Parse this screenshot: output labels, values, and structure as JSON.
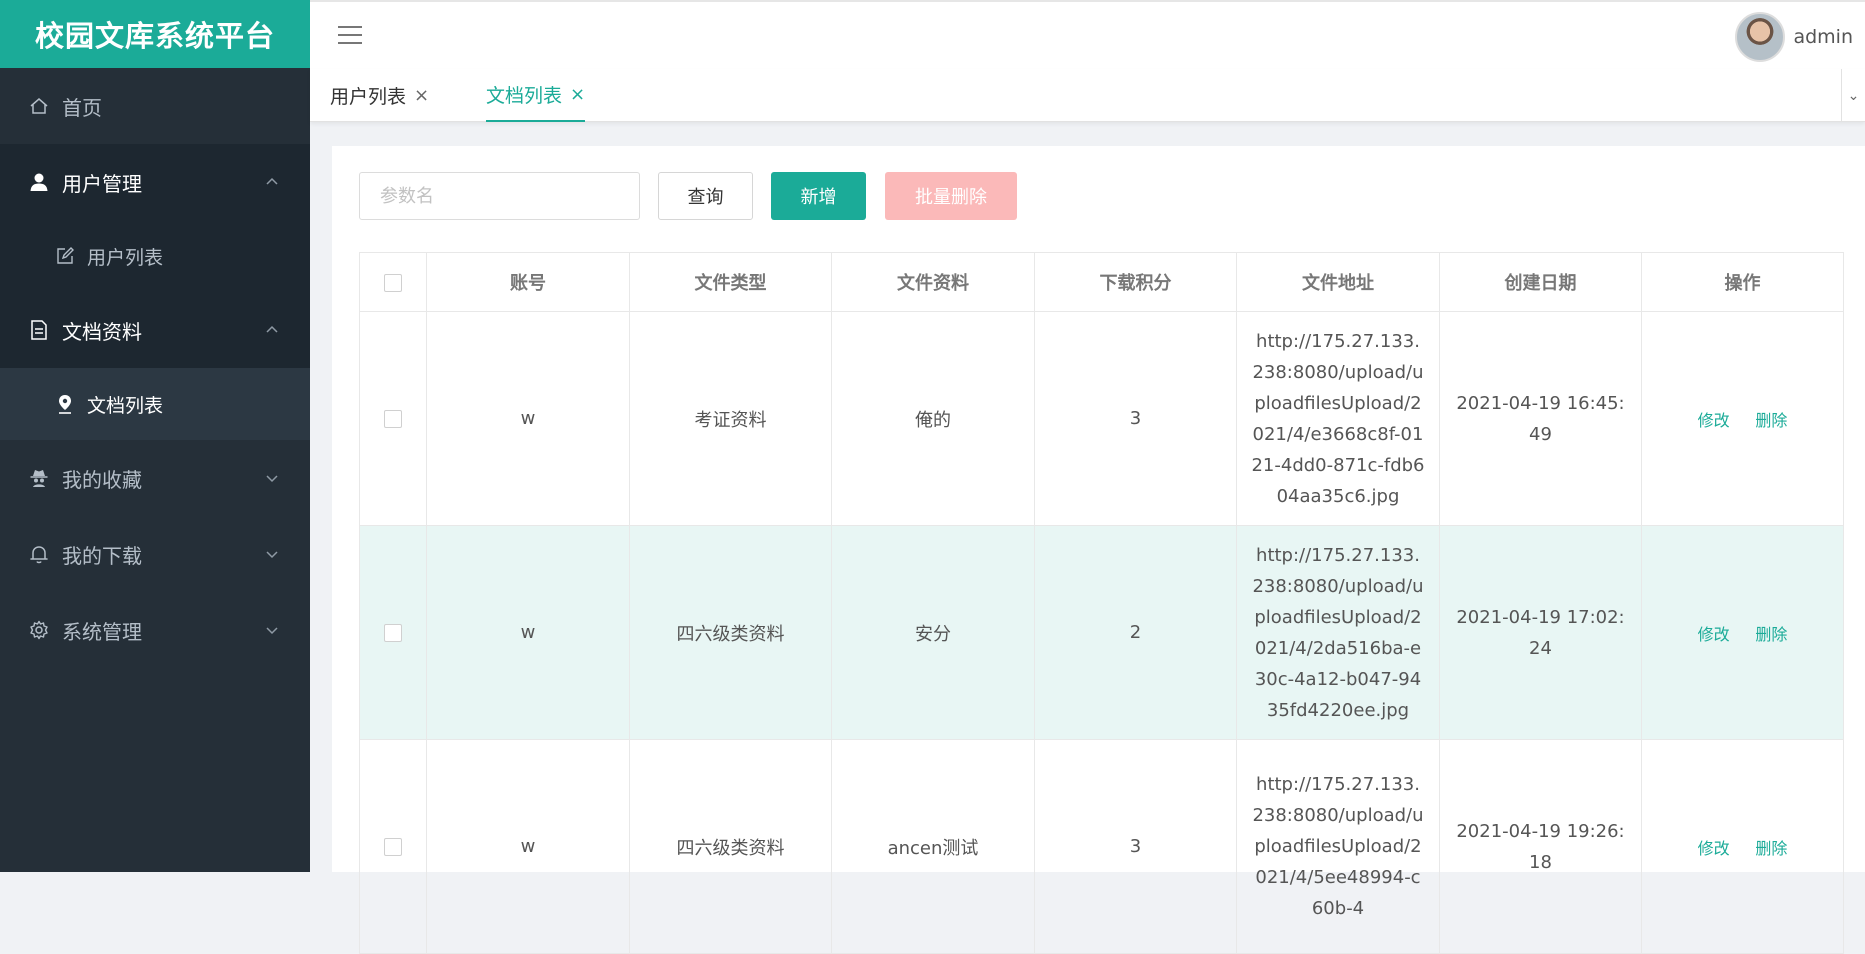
{
  "app": {
    "title": "校园文库系统平台"
  },
  "sidebar": {
    "home": "首页",
    "user_mgmt": "用户管理",
    "user_list": "用户列表",
    "doc": "文档资料",
    "doc_list": "文档列表",
    "favorites": "我的收藏",
    "downloads": "我的下载",
    "system": "系统管理"
  },
  "header": {
    "user": "admin"
  },
  "tabs": [
    {
      "label": "用户列表",
      "close": "×"
    },
    {
      "label": "文档列表",
      "close": "×"
    }
  ],
  "toolbar": {
    "search_placeholder": "参数名",
    "query": "查询",
    "add": "新增",
    "batch_delete": "批量删除"
  },
  "table": {
    "columns": [
      "账号",
      "文件类型",
      "文件资料",
      "下载积分",
      "文件地址",
      "创建日期",
      "操作"
    ],
    "rows": [
      {
        "account": "w",
        "type": "考证资料",
        "name": "俺的",
        "points": "3",
        "url": "http://175.27.133.238:8080/upload/uploadfilesUpload/2021/4/e3668c8f-0121-4dd0-871c-fdb604aa35c6.jpg",
        "date": "2021-04-19 16:45:49"
      },
      {
        "account": "w",
        "type": "四六级类资料",
        "name": "安分",
        "points": "2",
        "url": "http://175.27.133.238:8080/upload/uploadfilesUpload/2021/4/2da516ba-e30c-4a12-b047-9435fd4220ee.jpg",
        "date": "2021-04-19 17:02:24"
      },
      {
        "account": "w",
        "type": "四六级类资料",
        "name": "ancen测试",
        "points": "3",
        "url": "http://175.27.133.238:8080/upload/uploadfilesUpload/2021/4/5ee48994-c60b-4",
        "date": "2021-04-19 19:26:18"
      }
    ],
    "edit": "修改",
    "delete": "删除"
  },
  "colors": {
    "brand": "#1bab98",
    "sidebar": "#252f38",
    "danger_light": "#fbb9b9",
    "row_highlight": "#e8f6f4"
  }
}
